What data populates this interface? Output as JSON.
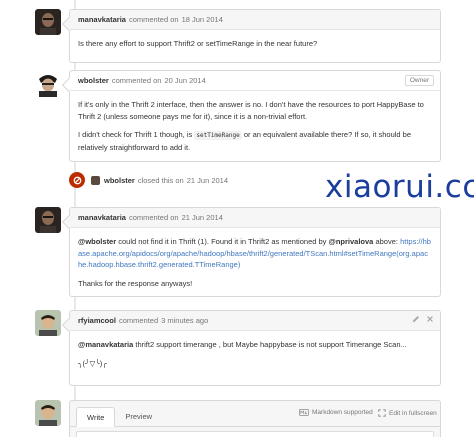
{
  "comments": [
    {
      "author": "manavkataria",
      "action": "commented on",
      "date": "18 Jun 2014",
      "body": "Is there any effort to support Thrift2 or setTimeRange in the near future?"
    },
    {
      "author": "wbolster",
      "action": "commented on",
      "date": "20 Jun 2014",
      "badge": "Owner",
      "p1": "If it's only in the Thrift 2 interface, then the answer is no. I don't have the resources to port HappyBase to Thrift 2 (unless someone pays me for it), since it is a non-trivial effort.",
      "p2_before": "I didn't check for Thrift 1 though, is",
      "p2_code": "setTimeRange",
      "p2_after": "or an equivalent available there? If so, it should be relatively straightforward to add it."
    },
    {
      "author": "manavkataria",
      "action": "commented on",
      "date": "21 Jun 2014",
      "mention1": "@wbolster",
      "text1": "could not find it in Thrift (1). Found it in Thrift2 as mentioned by",
      "mention2": "@nprivalova",
      "text2": "above:",
      "link": "https://hbase.apache.org/apidocs/org/apache/hadoop/hbase/thrift2/generated/TScan.html#setTimeRange(org.apache.hadoop.hbase.thrift2.generated.TTimeRange)",
      "thanks": "Thanks for the response anyways!"
    },
    {
      "author": "rfyiamcool",
      "action": "commented",
      "date": "3 minutes ago",
      "mention": "@manavkataria",
      "text": "thrift2 support timerange , but Maybe happybase is not support Timerange Scan...",
      "emoticon": "╮(╯▽╰)╭"
    }
  ],
  "event": {
    "author": "wbolster",
    "action": "closed this on",
    "date": "21 Jun 2014"
  },
  "watermark": "xiaorui.cc",
  "editor": {
    "tab_write": "Write",
    "tab_preview": "Preview",
    "markdown": "Markdown supported",
    "fullscreen": "Edit in fullscreen"
  },
  "icons": {
    "close_event": "circle-slash-icon",
    "edit": "pencil-icon",
    "delete": "x-icon",
    "markdown": "markdown-icon",
    "fullscreen": "screen-full-icon"
  },
  "colors": {
    "closed_event": "#bd2c00",
    "link": "#4078c0",
    "watermark": "#1a3d9e"
  }
}
